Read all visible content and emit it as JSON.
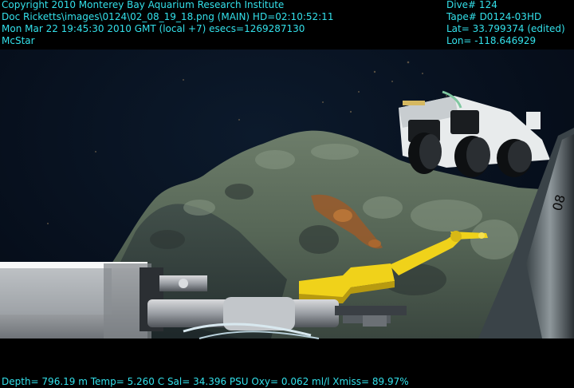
{
  "overlay": {
    "top_left": {
      "line1": "Copyright 2010 Monterey Bay Aquarium Research Institute",
      "line2": "Doc Ricketts\\images\\0124\\02_08_19_18.png (MAIN)  HD=02:10:52:11",
      "line3": "Mon Mar 22 19:45:30 2010 GMT (local +7)  esecs=1269287130",
      "line4": "McStar"
    },
    "top_right": {
      "dive": "Dive# 124",
      "tape": "Tape# D0124-03HD",
      "lat": "Lat= 33.799374 (edited)",
      "lon": "Lon= -118.646929"
    },
    "bottom": {
      "telemetry": "Depth= 796.19 m  Temp= 5.260 C  Sal= 34.396 PSU  Oxy= 0.062 ml/l  Xmiss= 89.97%"
    },
    "text_color": "#33e0ea"
  },
  "scene": {
    "subject": "ROV manipulator arm with yellow probe at seafloor rock outcrop, instrument package with black canisters in background"
  }
}
